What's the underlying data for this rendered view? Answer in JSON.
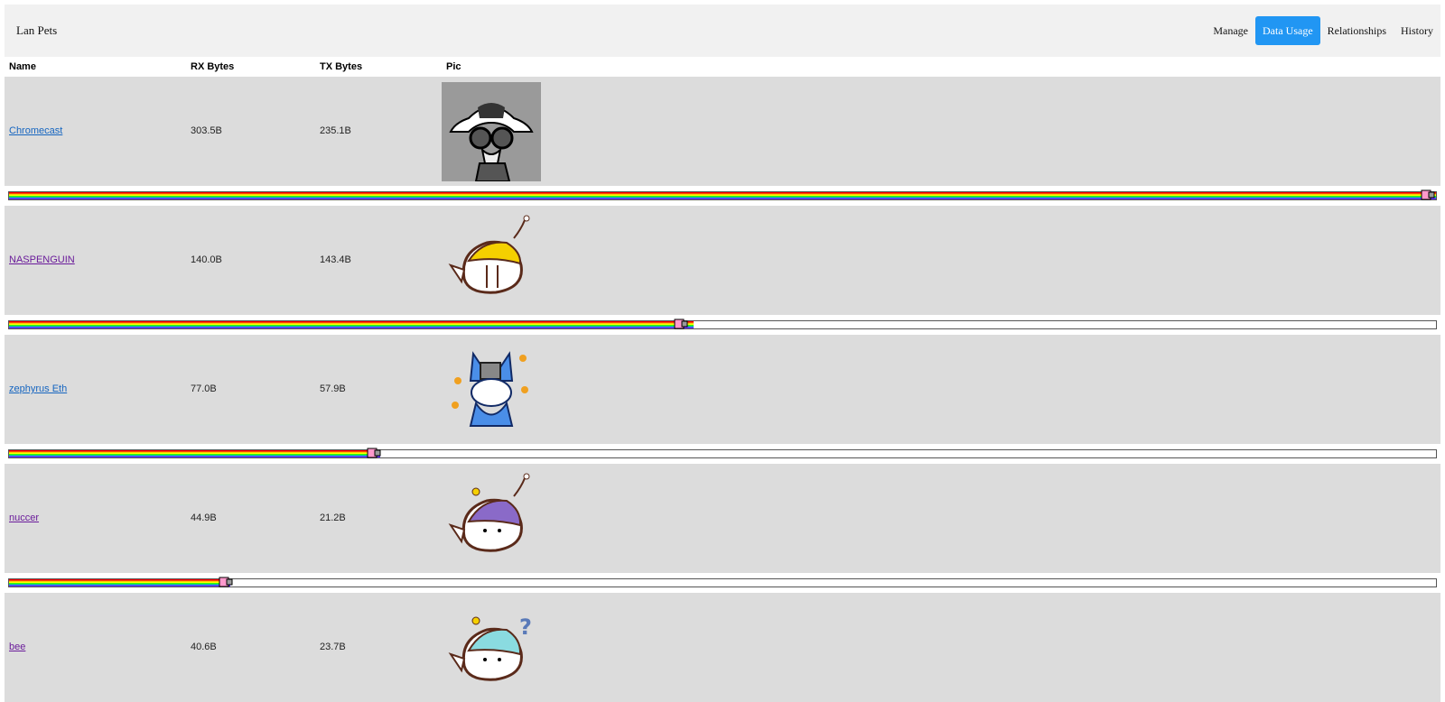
{
  "nav": {
    "brand": "Lan Pets",
    "links": [
      "Manage",
      "Data Usage",
      "Relationships",
      "History"
    ],
    "active": "Data Usage"
  },
  "table": {
    "headers": [
      "Name",
      "RX Bytes",
      "TX Bytes",
      "Pic"
    ],
    "rows": [
      {
        "name": "Chromecast",
        "rx": "303.5B",
        "tx": "235.1B",
        "pic": "gas-mask-character-pic",
        "visited": false,
        "usage": 1.0
      },
      {
        "name": "NASPENGUIN",
        "rx": "140.0B",
        "tx": "143.4B",
        "pic": "yellow-blob-pet-pic",
        "visited": true,
        "usage": 0.48
      },
      {
        "name": "zephyrus Eth",
        "rx": "77.0B",
        "tx": "57.9B",
        "pic": "blue-cat-pet-pic",
        "visited": false,
        "usage": 0.26
      },
      {
        "name": "nuccer",
        "rx": "44.9B",
        "tx": "21.2B",
        "pic": "purple-blob-pet-pic",
        "visited": true,
        "usage": 0.155
      },
      {
        "name": "bee",
        "rx": "40.6B",
        "tx": "23.7B",
        "pic": "cyan-blob-pet-pic",
        "visited": true,
        "usage": null
      }
    ]
  },
  "colors": {
    "active_nav": "#2196f3",
    "row_bg": "#dcdcdc",
    "link": "#1565c0",
    "visited_link": "#6a1b9a"
  }
}
